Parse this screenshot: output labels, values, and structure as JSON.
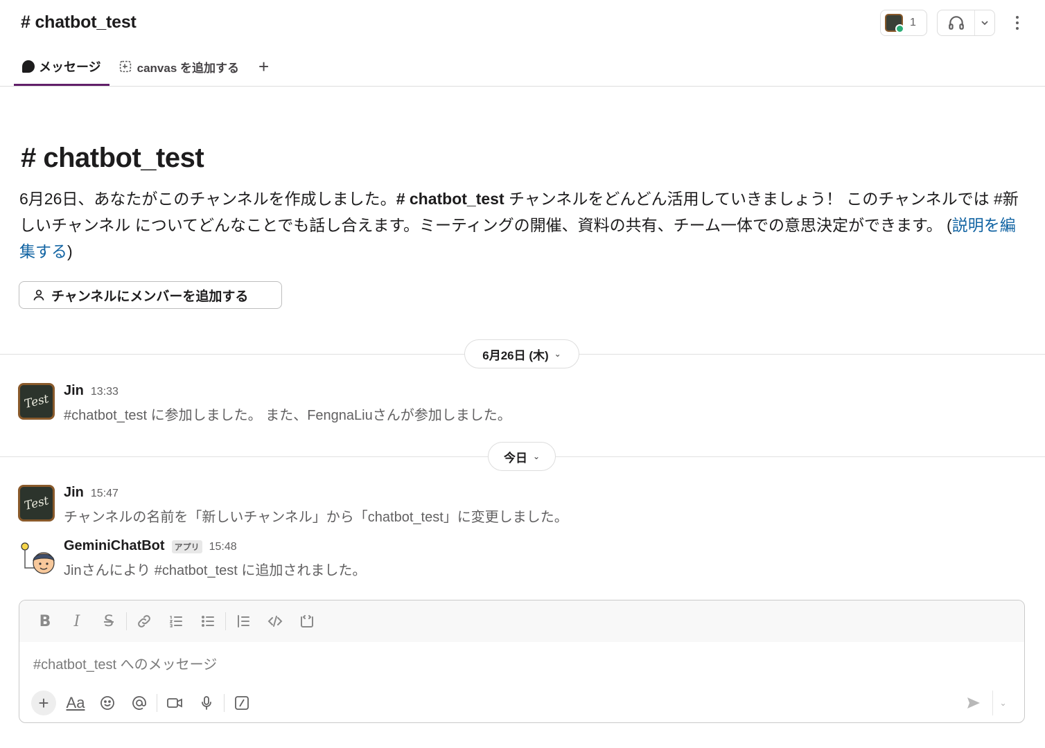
{
  "header": {
    "channel_title": "# chatbot_test",
    "member_count": "1"
  },
  "tabs": [
    {
      "label": "メッセージ"
    },
    {
      "label": "canvas を追加する"
    },
    {
      "label": "+"
    }
  ],
  "intro": {
    "title": "# chatbot_test",
    "desc_part1": "6月26日、あなたがこのチャンネルを作成しました。",
    "desc_channel": "# chatbot_test",
    "desc_part2": " チャンネルをどんどん活用していきましょう！ このチャンネルでは #新しいチャンネル についてどんなことでも話し合えます。ミーティングの開催、資料の共有、チーム一体での意思決定ができます。 (",
    "edit_link": "説明を編集する",
    "desc_close": ")",
    "add_member_button": "チャンネルにメンバーを追加する"
  },
  "dividers": [
    {
      "label": "6月26日 (木)"
    },
    {
      "label": "今日"
    }
  ],
  "messages": [
    {
      "author": "Jin",
      "time": "13:33",
      "text": "#chatbot_test に参加しました。 また、FengnaLiuさんが参加しました。",
      "avatar_text": "Test"
    },
    {
      "author": "Jin",
      "time": "15:47",
      "text": "チャンネルの名前を「新しいチャンネル」から「chatbot_test」に変更しました。",
      "avatar_text": "Test"
    },
    {
      "author": "GeminiChatBot",
      "badge": "アプリ",
      "time": "15:48",
      "text": "Jinさんにより #chatbot_test に追加されました。"
    }
  ],
  "composer": {
    "placeholder": "#chatbot_test へのメッセージ",
    "format_buttons": [
      "bold-icon",
      "italic-icon",
      "strikethrough-icon",
      "link-icon",
      "ordered-list-icon",
      "bulleted-list-icon",
      "blockquote-icon",
      "code-icon",
      "code-block-icon"
    ],
    "bottom_buttons": [
      "plus-icon",
      "text-format-icon",
      "emoji-icon",
      "mention-icon",
      "video-icon",
      "microphone-icon",
      "slash-command-icon"
    ],
    "text_format_label": "Aa"
  },
  "colors": {
    "accent": "#611f69",
    "link": "#1264a3",
    "online": "#2bac76"
  }
}
